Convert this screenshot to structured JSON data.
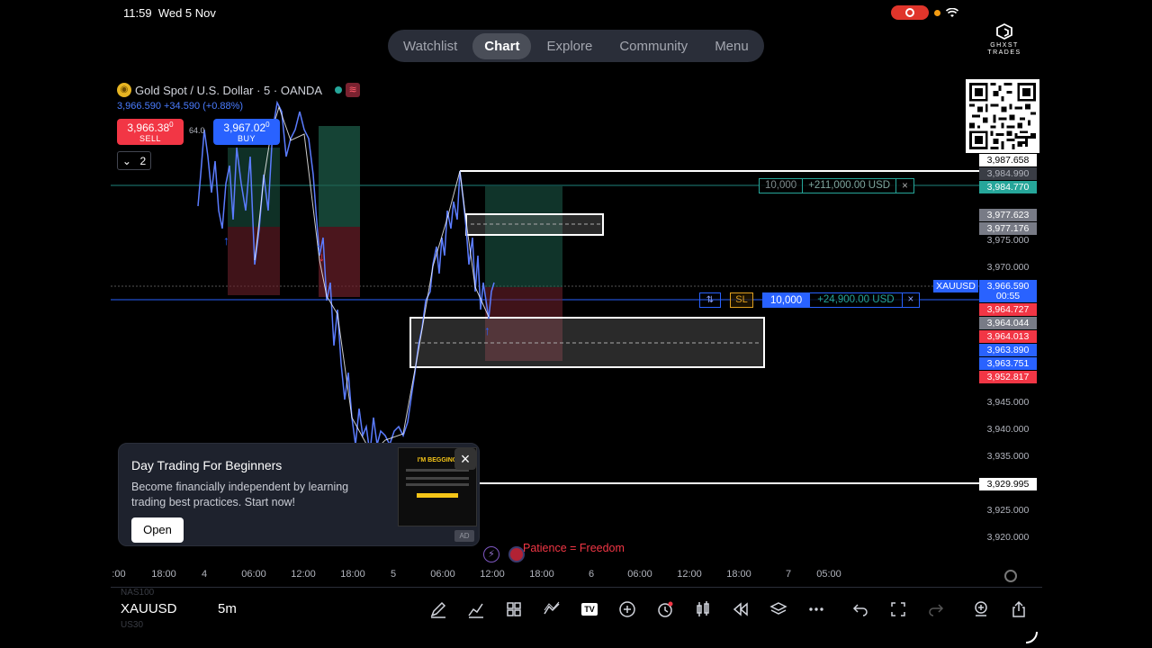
{
  "status_bar": {
    "time": "11:59",
    "date": "Wed 5 Nov"
  },
  "nav": {
    "tabs": [
      "Watchlist",
      "Chart",
      "Explore",
      "Community",
      "Menu"
    ],
    "active": "Chart"
  },
  "logo": {
    "line1": "GHXST",
    "line2": "TRADES"
  },
  "symbol": {
    "title": "Gold Spot / U.S. Dollar · 5 · OANDA",
    "ohlc": "3,966.590 +34.590 (+0.88%)"
  },
  "trade_panel": {
    "sell_price": "3,966.38",
    "sell_sup": "0",
    "sell_label": "SELL",
    "buy_price": "3,967.02",
    "buy_sup": "0",
    "buy_label": "BUY",
    "spread": "64.0",
    "collapse_count": "2"
  },
  "positions": {
    "green": {
      "qty": "10,000",
      "pnl": "+211,000.00 USD",
      "close": "×"
    },
    "blue": {
      "qty": "10,000",
      "pnl": "+24,900.00 USD",
      "close": "×"
    },
    "sl": "SL",
    "swap": "⇅",
    "symbol_tag": "XAUUSD"
  },
  "price_axis": {
    "labels": [
      {
        "text": "3,987.658",
        "bg": "#ffffff",
        "fg": "#000000"
      },
      {
        "text": "3,984.990",
        "bg": "#3a3d45",
        "fg": "#b2b5be"
      },
      {
        "text": "3,984.770",
        "bg": "#26a69a",
        "fg": "#ffffff"
      },
      {
        "text": "3,977.623",
        "bg": "#787b86",
        "fg": "#ffffff"
      },
      {
        "text": "3,977.176",
        "bg": "#787b86",
        "fg": "#ffffff"
      },
      {
        "text": "3,975.000",
        "bg": "",
        "fg": "#b2b5be"
      },
      {
        "text": "3,970.000",
        "bg": "",
        "fg": "#b2b5be"
      },
      {
        "text": "3,966.590",
        "bg": "#2962ff",
        "fg": "#ffffff"
      },
      {
        "text": "00:55",
        "bg": "#2962ff",
        "fg": "#ffffff"
      },
      {
        "text": "3,964.727",
        "bg": "#f23645",
        "fg": "#ffffff"
      },
      {
        "text": "3,964.044",
        "bg": "#787b86",
        "fg": "#ffffff"
      },
      {
        "text": "3,964.013",
        "bg": "#f23645",
        "fg": "#ffffff"
      },
      {
        "text": "3,963.890",
        "bg": "#2962ff",
        "fg": "#ffffff"
      },
      {
        "text": "3,963.751",
        "bg": "#2962ff",
        "fg": "#ffffff"
      },
      {
        "text": "3,952.817",
        "bg": "#f23645",
        "fg": "#ffffff"
      },
      {
        "text": "3,945.000",
        "bg": "",
        "fg": "#b2b5be"
      },
      {
        "text": "3,940.000",
        "bg": "",
        "fg": "#b2b5be"
      },
      {
        "text": "3,935.000",
        "bg": "",
        "fg": "#b2b5be"
      },
      {
        "text": "3,929.995",
        "bg": "#ffffff",
        "fg": "#000000"
      },
      {
        "text": "3,925.000",
        "bg": "",
        "fg": "#b2b5be"
      },
      {
        "text": "3,920.000",
        "bg": "",
        "fg": "#b2b5be"
      }
    ]
  },
  "time_axis": {
    "labels": [
      ":00",
      "18:00",
      "4",
      "06:00",
      "12:00",
      "18:00",
      "5",
      "06:00",
      "12:00",
      "18:00",
      "6",
      "06:00",
      "12:00",
      "18:00",
      "7",
      "05:00"
    ]
  },
  "ad": {
    "title": "Day Trading For Beginners",
    "description": "Become financially independent by learning trading best practices. Start now!",
    "button": "Open",
    "image_title": "I'M BEGGING",
    "tag": "AD",
    "close": "×"
  },
  "annotation": {
    "text": "Patience = Freedom"
  },
  "bottom_bar": {
    "ghost_top": "NAS100",
    "symbol": "XAUUSD",
    "ghost_bottom": "US30",
    "interval": "5m",
    "tools": [
      "pen-icon",
      "indicators-icon",
      "layouts-icon",
      "drawings-icon",
      "tradingview-icon",
      "add-icon",
      "alert-icon",
      "candles-icon",
      "replay-icon",
      "layers-icon",
      "more-icon",
      "undo-icon",
      "fullscreen-icon",
      "redo-icon",
      "object-tree-icon",
      "share-icon"
    ]
  }
}
